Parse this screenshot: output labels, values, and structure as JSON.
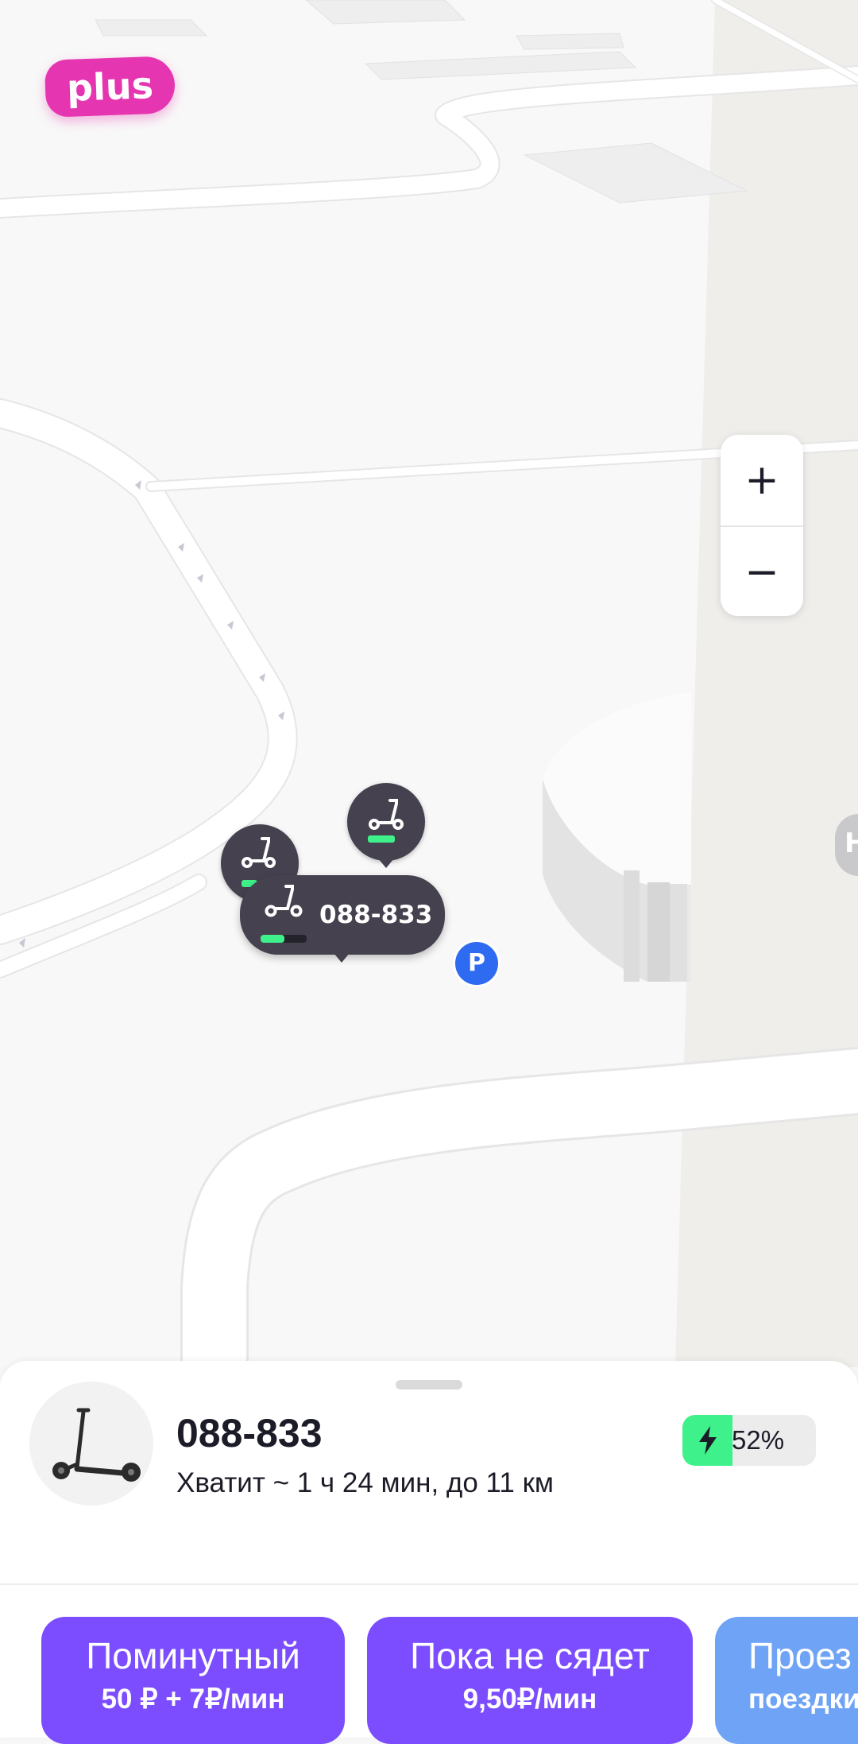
{
  "map": {
    "brand_badge": "plus",
    "zoom_in": "+",
    "zoom_out": "−",
    "selected_scooter_label": "088-833",
    "parking_label": "P",
    "edge_poi_label": "Н"
  },
  "scooter": {
    "id": "088-833",
    "range": "Хватит ~ 1 ч 24 мин, до 11 км",
    "battery_text": "52%",
    "battery_level": 0.52
  },
  "colors": {
    "brand_pink": "#e535b0",
    "tariff_purple": "#7b4dff",
    "tariff_blue": "#6fa3f5",
    "battery_green": "#3ff18a",
    "pin_dark": "#45414f",
    "parking_blue": "#2f6bf0"
  },
  "tariffs": [
    {
      "name": "Поминутный",
      "price": "50 ₽ + 7₽/мин"
    },
    {
      "name": "Пока не сядет",
      "price": "9,50₽/мин"
    },
    {
      "name": "Проез",
      "price": "поездки"
    }
  ]
}
